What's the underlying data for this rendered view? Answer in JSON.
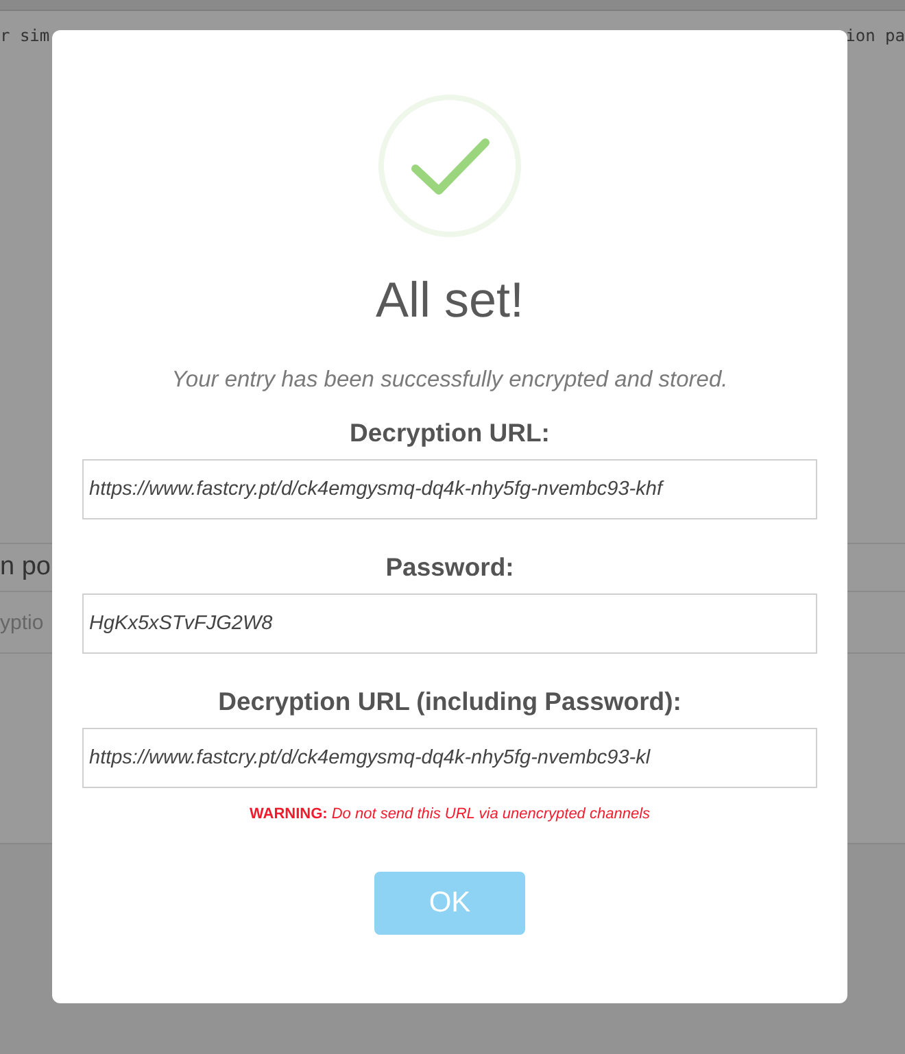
{
  "background": {
    "top_line": {
      "left": "r sim",
      "right": "ion pa"
    },
    "field_label": "n po",
    "field_placeholder": "yptio"
  },
  "dialog": {
    "title": "All set!",
    "message": "Your entry has been successfully encrypted and stored.",
    "fields": [
      {
        "label": "Decryption URL:",
        "value": "https://www.fastcry.pt/d/ck4emgysmq-dq4k-nhy5fg-nvembc93-khf"
      },
      {
        "label": "Password:",
        "value": "HgKx5xSTvFJG2W8"
      },
      {
        "label": "Decryption URL (including Password):",
        "value": "https://www.fastcry.pt/d/ck4emgysmq-dq4k-nhy5fg-nvembc93-kl"
      }
    ],
    "warning": "**WARNING:** Do not send this URL via unencrypted channels",
    "button": "OK"
  }
}
